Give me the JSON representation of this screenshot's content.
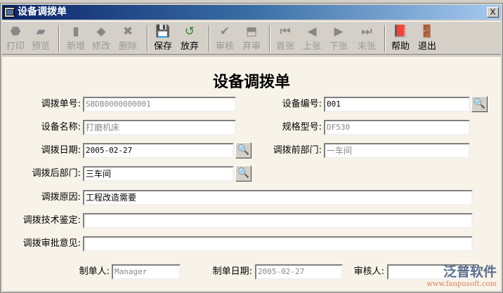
{
  "window": {
    "title": "设备调拨单",
    "close": "X"
  },
  "toolbar": [
    {
      "label": "打印",
      "icon": "printer-icon",
      "enabled": false,
      "glyph": "⬣"
    },
    {
      "label": "预览",
      "icon": "preview-icon",
      "enabled": false,
      "glyph": "▰"
    },
    {
      "label": "新增",
      "icon": "new-icon",
      "enabled": false,
      "glyph": "▮"
    },
    {
      "label": "修改",
      "icon": "edit-icon",
      "enabled": false,
      "glyph": "◆"
    },
    {
      "label": "删除",
      "icon": "delete-icon",
      "enabled": false,
      "glyph": "✖"
    },
    {
      "label": "保存",
      "icon": "save-icon",
      "enabled": true,
      "glyph": "💾"
    },
    {
      "label": "放弃",
      "icon": "undo-icon",
      "enabled": true,
      "glyph": "↺"
    },
    {
      "label": "审核",
      "icon": "check-icon",
      "enabled": false,
      "glyph": "✔"
    },
    {
      "label": "弃审",
      "icon": "unapprove-icon",
      "enabled": false,
      "glyph": "⬒"
    },
    {
      "label": "首张",
      "icon": "first-icon",
      "enabled": false,
      "glyph": "⏮"
    },
    {
      "label": "上张",
      "icon": "prev-icon",
      "enabled": false,
      "glyph": "◀"
    },
    {
      "label": "下张",
      "icon": "next-icon",
      "enabled": false,
      "glyph": "▶"
    },
    {
      "label": "末张",
      "icon": "last-icon",
      "enabled": false,
      "glyph": "⏭"
    },
    {
      "label": "帮助",
      "icon": "help-book-icon",
      "enabled": true,
      "glyph": "📕"
    },
    {
      "label": "退出",
      "icon": "exit-door-icon",
      "enabled": true,
      "glyph": "🚪"
    }
  ],
  "form": {
    "title": "设备调拨单",
    "transfer_no": {
      "label": "调拨单号:",
      "value": "SBDB0000000001"
    },
    "equipment_no": {
      "label": "设备编号:",
      "value": "001"
    },
    "equipment_name": {
      "label": "设备名称:",
      "value": "打磨机床"
    },
    "spec": {
      "label": "规格型号:",
      "value": "DF530"
    },
    "transfer_date": {
      "label": "调拨日期:",
      "value": "2005-02-27"
    },
    "dept_before": {
      "label": "调拨前部门:",
      "value": "一车间"
    },
    "dept_after": {
      "label": "调拨后部门:",
      "value": "三车间"
    },
    "reason": {
      "label": "调拨原因:",
      "value": "工程改造需要"
    },
    "tech": {
      "label": "调拨技术鉴定:",
      "value": ""
    },
    "approval": {
      "label": "调拨审批意见:",
      "value": ""
    },
    "creator": {
      "label": "制单人:",
      "value": "Manager"
    },
    "create_date": {
      "label": "制单日期:",
      "value": "2005-02-27"
    },
    "auditor": {
      "label": "审核人:",
      "value": ""
    }
  },
  "watermark": {
    "name": "泛普软件",
    "url": "www.fanpusoft.com"
  }
}
